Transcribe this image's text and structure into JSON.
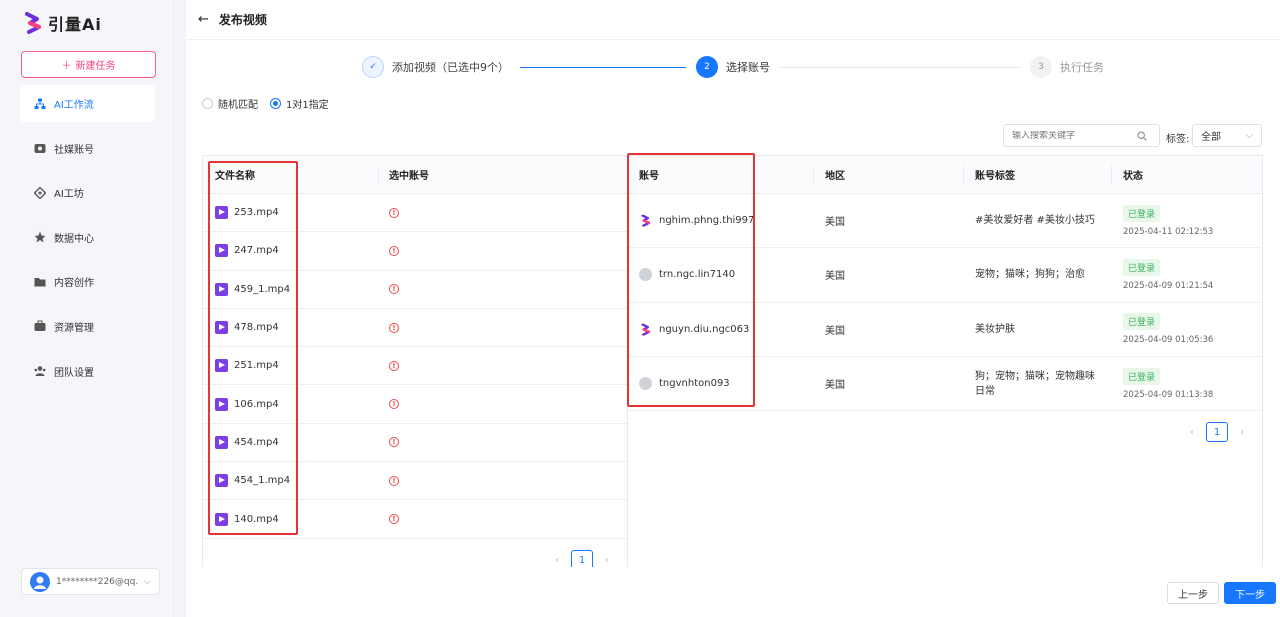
{
  "app": {
    "logo_text": "引量Ai",
    "new_task_label": "新建任务"
  },
  "sidebar": {
    "items": [
      {
        "label": "AI工作流",
        "icon": "workflow-icon",
        "active": true
      },
      {
        "label": "社媒账号",
        "icon": "social-account-icon"
      },
      {
        "label": "AI工坊",
        "icon": "ai-workshop-icon"
      },
      {
        "label": "数据中心",
        "icon": "data-center-icon"
      },
      {
        "label": "内容创作",
        "icon": "folder-icon"
      },
      {
        "label": "资源管理",
        "icon": "briefcase-icon"
      },
      {
        "label": "团队设置",
        "icon": "team-icon"
      }
    ],
    "user": "1********226@qq..."
  },
  "header": {
    "title": "发布视频",
    "back": "←"
  },
  "steps": [
    {
      "num": "✓",
      "label": "添加视频（已选中9个）",
      "state": "done"
    },
    {
      "num": "2",
      "label": "选择账号",
      "state": "active"
    },
    {
      "num": "3",
      "label": "执行任务",
      "state": "pending"
    }
  ],
  "mode": {
    "options": [
      "随机匹配",
      "1对1指定"
    ],
    "selected": "1对1指定"
  },
  "filter": {
    "search_placeholder": "输入搜索关键字",
    "tag_label": "标签:",
    "tag_value": "全部"
  },
  "files_table": {
    "headers": [
      "文件名称",
      "选中账号"
    ],
    "rows": [
      "253.mp4",
      "247.mp4",
      "459_1.mp4",
      "478.mp4",
      "251.mp4",
      "106.mp4",
      "454.mp4",
      "454_1.mp4",
      "140.mp4"
    ],
    "warn_glyph": "!",
    "page": "1"
  },
  "accounts_table": {
    "headers": [
      "账号",
      "地区",
      "账号标签",
      "状态"
    ],
    "rows": [
      {
        "account": "nghim.phng.thi997",
        "region": "美国",
        "tags": "#美妆爱好者 #美妆小技巧",
        "status": "已登录",
        "time": "2025-04-11 02:12:53",
        "icon": "brand"
      },
      {
        "account": "trn.ngc.lin7140",
        "region": "美国",
        "tags": "宠物；猫咪；狗狗；治愈",
        "status": "已登录",
        "time": "2025-04-09 01:21:54",
        "icon": "grey"
      },
      {
        "account": "nguyn.diu.ngc063",
        "region": "美国",
        "tags": "美妆护肤",
        "status": "已登录",
        "time": "2025-04-09 01:05:36",
        "icon": "brand"
      },
      {
        "account": "tngvnhton093",
        "region": "美国",
        "tags": "狗；宠物；猫咪；宠物趣味日常",
        "status": "已登录",
        "time": "2025-04-09 01:13:38",
        "icon": "grey"
      }
    ],
    "page": "1"
  },
  "footer": {
    "prev_label": "上一步",
    "next_label": "下一步"
  },
  "colors": {
    "primary": "#1677ff",
    "brand_pink": "#ff3f7a",
    "highlight_red": "#e53535"
  }
}
